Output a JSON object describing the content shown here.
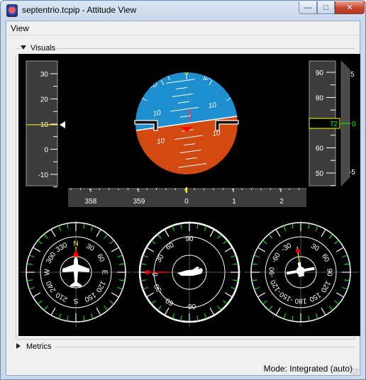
{
  "window": {
    "title": "septentrio.tcpip - Attitude View",
    "minimize_glyph": "—",
    "maximize_glyph": "□",
    "close_glyph": "✕"
  },
  "menu": {
    "view": "View"
  },
  "groups": {
    "visuals": "Visuals",
    "metrics": "Metrics"
  },
  "status": {
    "mode": "Mode: Integrated (auto)"
  },
  "instruments": {
    "left_tape": {
      "ticks": [
        "30",
        "20",
        "10",
        "0",
        "-10"
      ],
      "value": 12
    },
    "right_tape": {
      "ticks": [
        "90",
        "80",
        "70",
        "60",
        "50"
      ],
      "value": "72"
    },
    "vsi": {
      "ticks": [
        "5",
        "0",
        "-5"
      ]
    },
    "attitude": {
      "sky_color": "#1e90d0",
      "ground_color": "#d24a12",
      "pitch_labels_up": [
        "20",
        "20",
        "10",
        "10"
      ],
      "pitch_labels_down": [
        "10",
        "10"
      ],
      "roll_deg": -8
    },
    "heading_tape": {
      "labels": [
        "358",
        "359",
        "0",
        "1",
        "2"
      ]
    },
    "compass": {
      "labels": [
        "N",
        "30",
        "60",
        "E",
        "120",
        "150",
        "S",
        "210",
        "240",
        "W",
        "300",
        "330"
      ],
      "heading_deg": 0
    },
    "pitch_dial": {
      "labels": [
        "90",
        "60",
        "30",
        "0",
        "-30",
        "-60",
        "-90",
        "30",
        "60"
      ]
    },
    "roll_dial": {
      "labels": [
        "-30",
        "-60",
        "-90",
        "-120",
        "-150",
        "180",
        "150",
        "120",
        "90",
        "60",
        "30"
      ]
    }
  },
  "colors": {
    "accent_green": "#00ff00",
    "accent_red": "#ff0000",
    "accent_yellow": "#ffff00"
  }
}
